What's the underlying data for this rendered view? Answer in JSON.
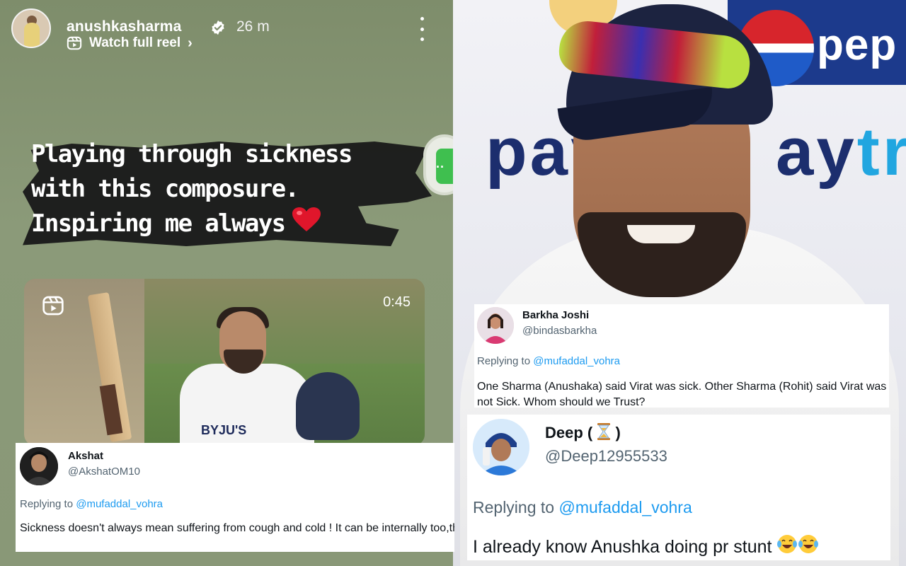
{
  "story": {
    "username": "anushkasharma",
    "time_ago": "26 m",
    "watch_reel_label": "Watch full reel",
    "caption_lines": [
      "Playing through sickness",
      "with this composure.",
      "Inspiring me always"
    ],
    "caption_emoji": "heart",
    "reel_duration": "0:45",
    "jersey_text": "BYJU'S"
  },
  "photo": {
    "sponsor_top": "pep",
    "sponsor_left": "pay",
    "sponsor_right_prefix": "ay",
    "sponsor_right_accent": "tr"
  },
  "tweets": {
    "akshat": {
      "name": "Akshat",
      "handle": "@AkshatOM10",
      "reply_prefix": "Replying to",
      "reply_mention": "@mufaddal_vohra",
      "text": "Sickness doesn't always mean suffering from cough and cold ! It can be internally too,the tiredness of body etc."
    },
    "barkha": {
      "name": "Barkha Joshi",
      "handle": "@bindasbarkha",
      "reply_prefix": "Replying to",
      "reply_mention": "@mufaddal_vohra",
      "text": "One Sharma (Anushaka) said Virat was sick. Other Sharma (Rohit) said Virat was not Sick. Whom should we Trust?"
    },
    "deep": {
      "name": "Deep (",
      "name_suffix": ")",
      "handle": "@Deep12955533",
      "reply_prefix": "Replying to",
      "reply_mention": "@mufaddal_vohra",
      "text": "I already know Anushka doing pr stunt"
    }
  },
  "colors": {
    "story_bg": "#899877",
    "link_blue": "#1d9bf0",
    "handle_gray": "#536471",
    "paytm_navy": "#1c2e6e",
    "pepsi_blue": "#1c3a8c"
  },
  "icons": [
    "verified-badge-icon",
    "reel-icon",
    "chevron-right-icon",
    "more-options-icon",
    "heart-emoji-icon",
    "hourglass-emoji-icon",
    "laughing-crying-emoji-icon"
  ]
}
